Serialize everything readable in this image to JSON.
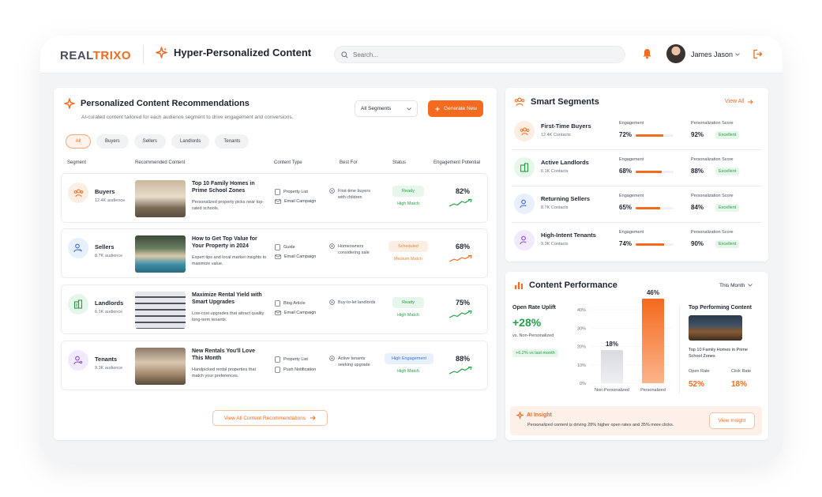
{
  "app": {
    "logo_part1": "REAL",
    "logo_part2": "TRIXO",
    "title": "Hyper-Personalized Content"
  },
  "search": {
    "placeholder": "Search..."
  },
  "user": {
    "name": "James Jason"
  },
  "recommendations": {
    "title": "Personalized Content Recommendations",
    "subtitle": "AI-curated content tailored for each audience segment to drive engagement and conversions.",
    "segment_select": "All Segments",
    "generate_label": "Generate New",
    "filters": [
      "All",
      "Buyers",
      "Sellers",
      "Landlords",
      "Tenants"
    ],
    "columns": [
      "Segment",
      "Recommended Content",
      "Content Type",
      "Best For",
      "Status",
      "Engagement Potential"
    ],
    "rows": [
      {
        "segment": "Buyers",
        "audience": "12.4K audience",
        "title": "Top 10 Family Homes in Prime School Zones",
        "desc": "Personalized property picks near top-rated schools.",
        "type1": "Property List",
        "type2": "Email Campaign",
        "best_for": "First-time buyers with children",
        "status": "Ready",
        "match": "High Match",
        "potential": "82%"
      },
      {
        "segment": "Sellers",
        "audience": "8.7K audience",
        "title": "How to Get Top Value for Your Property in 2024",
        "desc": "Expert tips and local market insights to maximize value.",
        "type1": "Guide",
        "type2": "Email Campaign",
        "best_for": "Homeowners considering sale",
        "status": "Scheduled",
        "match": "Medium Match",
        "potential": "68%"
      },
      {
        "segment": "Landlords",
        "audience": "6.1K audience",
        "title": "Maximize Rental Yield with Smart Upgrades",
        "desc": "Low-cost upgrades that attract quality long-term tenants.",
        "type1": "Blog Article",
        "type2": "Email Campaign",
        "best_for": "Buy-to-let landlords",
        "status": "Ready",
        "match": "High Match",
        "potential": "75%"
      },
      {
        "segment": "Tenants",
        "audience": "9.3K audience",
        "title": "New Rentals You'll Love This Month",
        "desc": "Handpicked rental properties that match your preferences.",
        "type1": "Property List",
        "type2": "Push Notification",
        "best_for": "Active tenants seeking upgrade",
        "status": "High Engagement",
        "match": "High Match",
        "potential": "88%"
      }
    ],
    "view_all_label": "View All Content Recommendations"
  },
  "segments": {
    "title": "Smart Segments",
    "view_all": "View All",
    "engagement_label": "Engagement",
    "score_label": "Personalization Score",
    "items": [
      {
        "name": "First-Time Buyers",
        "contacts": "12.4K Contacts",
        "engagement": "72%",
        "engagement_value": 72,
        "score": "92%",
        "rating": "Excellent"
      },
      {
        "name": "Active Landlords",
        "contacts": "6.1K Contacts",
        "engagement": "68%",
        "engagement_value": 68,
        "score": "88%",
        "rating": "Excellent"
      },
      {
        "name": "Returning Sellers",
        "contacts": "8.7K Contacts",
        "engagement": "65%",
        "engagement_value": 65,
        "score": "84%",
        "rating": "Excellent"
      },
      {
        "name": "High-Intent Tenants",
        "contacts": "9.3K Contacts",
        "engagement": "74%",
        "engagement_value": 74,
        "score": "90%",
        "rating": "Excellent"
      }
    ]
  },
  "performance": {
    "title": "Content Performance",
    "period": "This Month",
    "uplift_label": "Open Rate Uplift",
    "uplift_value": "+28%",
    "uplift_sub": "vs. Non-Personalized",
    "uplift_badge": "+6.2% vs last month",
    "top_title": "Top Performing Content",
    "top_name": "Top 10 Family Homes in Prime School Zones",
    "open_rate_label": "Open Rate",
    "open_rate": "52%",
    "click_rate_label": "Click Rate",
    "click_rate": "18%",
    "insight_title": "AI Insight",
    "insight_text": "Personalized content is driving 28% higher open rates and 35% more clicks.",
    "insight_button": "View Insight"
  },
  "chart_data": {
    "type": "bar",
    "categories": [
      "Non-Personalized",
      "Personalized"
    ],
    "values": [
      18,
      46
    ],
    "data_labels": [
      "18%",
      "46%"
    ],
    "ylim": [
      0,
      40
    ],
    "yticks": [
      "0%",
      "10%",
      "20%",
      "30%",
      "40%"
    ]
  },
  "colors": {
    "accent": "#f46a1f",
    "success": "#22a046",
    "scheduled": "#e8873a",
    "info": "#3b6fd8"
  }
}
